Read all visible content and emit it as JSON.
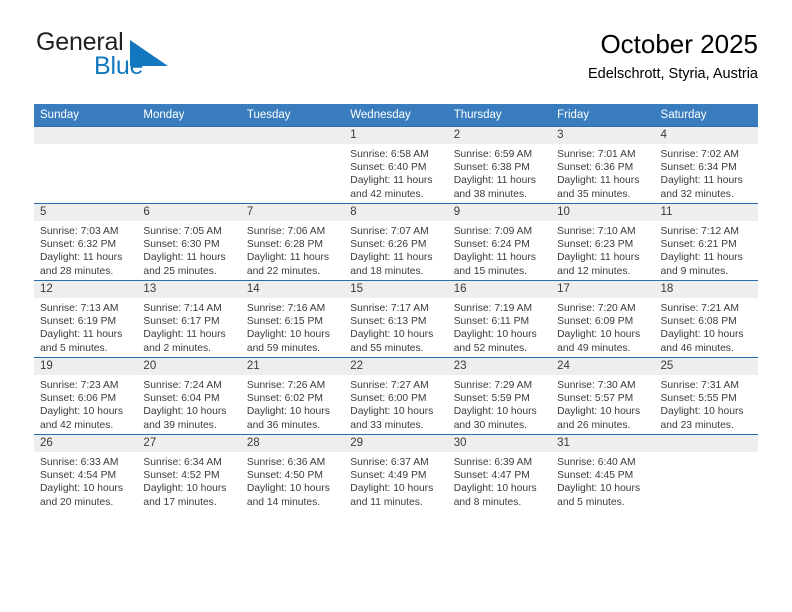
{
  "brand": {
    "name_part1": "General",
    "name_part2": "Blue",
    "color_primary": "#1277bf",
    "color_dark": "#231f20"
  },
  "header": {
    "title": "October 2025",
    "location": "Edelschrott, Styria, Austria"
  },
  "theme": {
    "header_row_bg": "#3a7dbf",
    "row_divider": "#2a6ead",
    "daynum_band_bg": "#eeeeee",
    "text": "#3b3b3b"
  },
  "weekday_headers": [
    "Sunday",
    "Monday",
    "Tuesday",
    "Wednesday",
    "Thursday",
    "Friday",
    "Saturday"
  ],
  "weeks": [
    [
      {
        "day": "",
        "lines": []
      },
      {
        "day": "",
        "lines": []
      },
      {
        "day": "",
        "lines": []
      },
      {
        "day": "1",
        "lines": [
          "Sunrise: 6:58 AM",
          "Sunset: 6:40 PM",
          "Daylight: 11 hours",
          "and 42 minutes."
        ]
      },
      {
        "day": "2",
        "lines": [
          "Sunrise: 6:59 AM",
          "Sunset: 6:38 PM",
          "Daylight: 11 hours",
          "and 38 minutes."
        ]
      },
      {
        "day": "3",
        "lines": [
          "Sunrise: 7:01 AM",
          "Sunset: 6:36 PM",
          "Daylight: 11 hours",
          "and 35 minutes."
        ]
      },
      {
        "day": "4",
        "lines": [
          "Sunrise: 7:02 AM",
          "Sunset: 6:34 PM",
          "Daylight: 11 hours",
          "and 32 minutes."
        ]
      }
    ],
    [
      {
        "day": "5",
        "lines": [
          "Sunrise: 7:03 AM",
          "Sunset: 6:32 PM",
          "Daylight: 11 hours",
          "and 28 minutes."
        ]
      },
      {
        "day": "6",
        "lines": [
          "Sunrise: 7:05 AM",
          "Sunset: 6:30 PM",
          "Daylight: 11 hours",
          "and 25 minutes."
        ]
      },
      {
        "day": "7",
        "lines": [
          "Sunrise: 7:06 AM",
          "Sunset: 6:28 PM",
          "Daylight: 11 hours",
          "and 22 minutes."
        ]
      },
      {
        "day": "8",
        "lines": [
          "Sunrise: 7:07 AM",
          "Sunset: 6:26 PM",
          "Daylight: 11 hours",
          "and 18 minutes."
        ]
      },
      {
        "day": "9",
        "lines": [
          "Sunrise: 7:09 AM",
          "Sunset: 6:24 PM",
          "Daylight: 11 hours",
          "and 15 minutes."
        ]
      },
      {
        "day": "10",
        "lines": [
          "Sunrise: 7:10 AM",
          "Sunset: 6:23 PM",
          "Daylight: 11 hours",
          "and 12 minutes."
        ]
      },
      {
        "day": "11",
        "lines": [
          "Sunrise: 7:12 AM",
          "Sunset: 6:21 PM",
          "Daylight: 11 hours",
          "and 9 minutes."
        ]
      }
    ],
    [
      {
        "day": "12",
        "lines": [
          "Sunrise: 7:13 AM",
          "Sunset: 6:19 PM",
          "Daylight: 11 hours",
          "and 5 minutes."
        ]
      },
      {
        "day": "13",
        "lines": [
          "Sunrise: 7:14 AM",
          "Sunset: 6:17 PM",
          "Daylight: 11 hours",
          "and 2 minutes."
        ]
      },
      {
        "day": "14",
        "lines": [
          "Sunrise: 7:16 AM",
          "Sunset: 6:15 PM",
          "Daylight: 10 hours",
          "and 59 minutes."
        ]
      },
      {
        "day": "15",
        "lines": [
          "Sunrise: 7:17 AM",
          "Sunset: 6:13 PM",
          "Daylight: 10 hours",
          "and 55 minutes."
        ]
      },
      {
        "day": "16",
        "lines": [
          "Sunrise: 7:19 AM",
          "Sunset: 6:11 PM",
          "Daylight: 10 hours",
          "and 52 minutes."
        ]
      },
      {
        "day": "17",
        "lines": [
          "Sunrise: 7:20 AM",
          "Sunset: 6:09 PM",
          "Daylight: 10 hours",
          "and 49 minutes."
        ]
      },
      {
        "day": "18",
        "lines": [
          "Sunrise: 7:21 AM",
          "Sunset: 6:08 PM",
          "Daylight: 10 hours",
          "and 46 minutes."
        ]
      }
    ],
    [
      {
        "day": "19",
        "lines": [
          "Sunrise: 7:23 AM",
          "Sunset: 6:06 PM",
          "Daylight: 10 hours",
          "and 42 minutes."
        ]
      },
      {
        "day": "20",
        "lines": [
          "Sunrise: 7:24 AM",
          "Sunset: 6:04 PM",
          "Daylight: 10 hours",
          "and 39 minutes."
        ]
      },
      {
        "day": "21",
        "lines": [
          "Sunrise: 7:26 AM",
          "Sunset: 6:02 PM",
          "Daylight: 10 hours",
          "and 36 minutes."
        ]
      },
      {
        "day": "22",
        "lines": [
          "Sunrise: 7:27 AM",
          "Sunset: 6:00 PM",
          "Daylight: 10 hours",
          "and 33 minutes."
        ]
      },
      {
        "day": "23",
        "lines": [
          "Sunrise: 7:29 AM",
          "Sunset: 5:59 PM",
          "Daylight: 10 hours",
          "and 30 minutes."
        ]
      },
      {
        "day": "24",
        "lines": [
          "Sunrise: 7:30 AM",
          "Sunset: 5:57 PM",
          "Daylight: 10 hours",
          "and 26 minutes."
        ]
      },
      {
        "day": "25",
        "lines": [
          "Sunrise: 7:31 AM",
          "Sunset: 5:55 PM",
          "Daylight: 10 hours",
          "and 23 minutes."
        ]
      }
    ],
    [
      {
        "day": "26",
        "lines": [
          "Sunrise: 6:33 AM",
          "Sunset: 4:54 PM",
          "Daylight: 10 hours",
          "and 20 minutes."
        ]
      },
      {
        "day": "27",
        "lines": [
          "Sunrise: 6:34 AM",
          "Sunset: 4:52 PM",
          "Daylight: 10 hours",
          "and 17 minutes."
        ]
      },
      {
        "day": "28",
        "lines": [
          "Sunrise: 6:36 AM",
          "Sunset: 4:50 PM",
          "Daylight: 10 hours",
          "and 14 minutes."
        ]
      },
      {
        "day": "29",
        "lines": [
          "Sunrise: 6:37 AM",
          "Sunset: 4:49 PM",
          "Daylight: 10 hours",
          "and 11 minutes."
        ]
      },
      {
        "day": "30",
        "lines": [
          "Sunrise: 6:39 AM",
          "Sunset: 4:47 PM",
          "Daylight: 10 hours",
          "and 8 minutes."
        ]
      },
      {
        "day": "31",
        "lines": [
          "Sunrise: 6:40 AM",
          "Sunset: 4:45 PM",
          "Daylight: 10 hours",
          "and 5 minutes."
        ]
      },
      {
        "day": "",
        "lines": []
      }
    ]
  ]
}
